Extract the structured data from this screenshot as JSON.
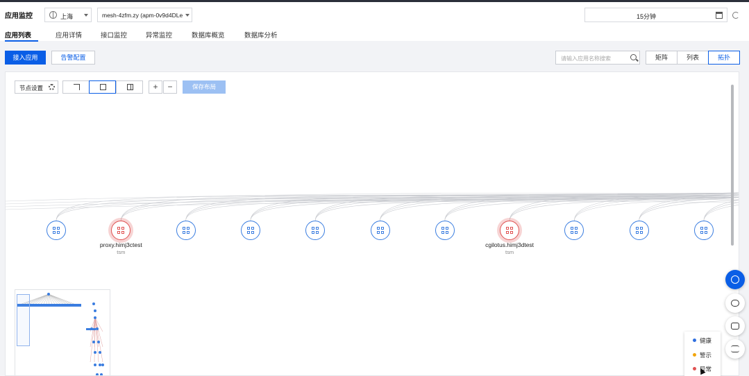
{
  "header": {
    "app_title": "应用监控",
    "region": "上海",
    "instance": "mesh-4zfm.zy (apm-0v9d4DLe",
    "time_range": "15分钟"
  },
  "tabs": [
    {
      "label": "应用列表",
      "active": true
    },
    {
      "label": "应用详情",
      "active": false
    },
    {
      "label": "接口监控",
      "active": false
    },
    {
      "label": "异常监控",
      "active": false
    },
    {
      "label": "数据库概览",
      "active": false
    },
    {
      "label": "数据库分析",
      "active": false
    }
  ],
  "toolbar": {
    "add_app": "接入应用",
    "alarm_config": "告警配置",
    "search_placeholder": "请输入应用名称搜索",
    "views": [
      "矩阵",
      "列表",
      "拓扑"
    ],
    "active_view": "拓扑"
  },
  "topology": {
    "node_settings": "节点设置",
    "save_layout": "保存布局",
    "zoom_in": "+",
    "zoom_out": "−",
    "nodes": [
      {
        "name": "",
        "sub": "",
        "status": "normal"
      },
      {
        "name": "proxy.himj3ctest",
        "sub": "tsm",
        "status": "error"
      },
      {
        "name": "",
        "sub": "",
        "status": "normal"
      },
      {
        "name": "",
        "sub": "",
        "status": "normal"
      },
      {
        "name": "",
        "sub": "",
        "status": "normal"
      },
      {
        "name": "",
        "sub": "",
        "status": "normal"
      },
      {
        "name": "",
        "sub": "",
        "status": "normal"
      },
      {
        "name": "cgilotus.himj3dtest",
        "sub": "tsm",
        "status": "error"
      },
      {
        "name": "",
        "sub": "",
        "status": "normal"
      },
      {
        "name": "",
        "sub": "",
        "status": "normal"
      },
      {
        "name": "",
        "sub": "",
        "status": "normal"
      }
    ]
  },
  "legend": [
    {
      "label": "健康",
      "color": "#2f6fe0"
    },
    {
      "label": "警示",
      "color": "#f2a50c"
    },
    {
      "label": "异常",
      "color": "#e05252"
    }
  ],
  "colors": {
    "accent": "#0a5ee6",
    "error": "#e05252",
    "normal": "#3a7de0"
  }
}
